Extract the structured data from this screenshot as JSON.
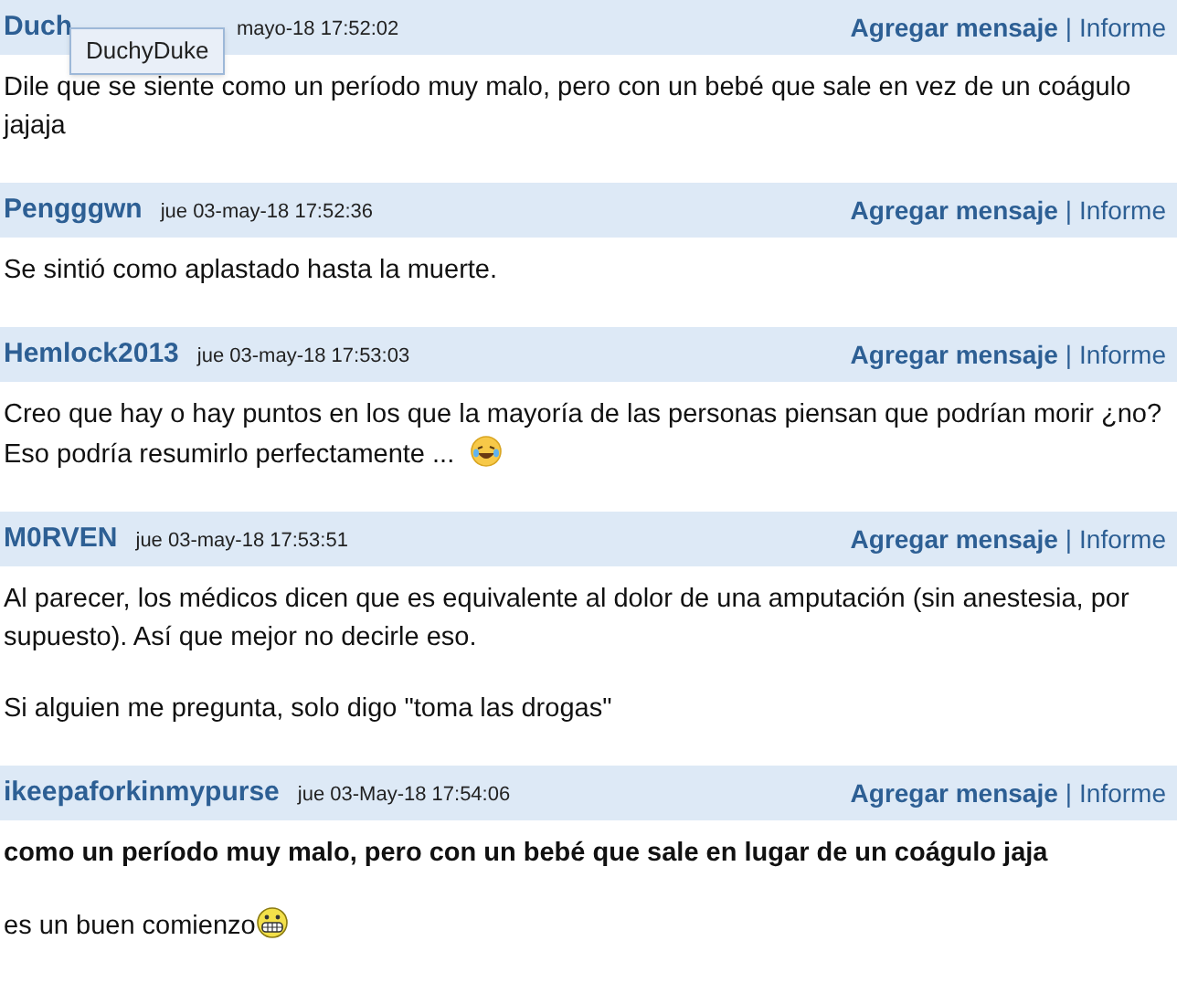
{
  "tooltip": {
    "text": "DuchyDuke"
  },
  "posts": [
    {
      "user": "Duch",
      "date": "mayo-18 17:52:02",
      "actions": {
        "reply": "Agregar mensaje",
        "separator": "|",
        "report": "Informe"
      },
      "paragraphs": [
        {
          "text": "Dile que se siente como un período muy malo, pero con un bebé que sale en vez de un coágulo jajaja",
          "bold": false
        }
      ]
    },
    {
      "user": "Pengggwn",
      "date": "jue 03-may-18 17:52:36",
      "actions": {
        "reply": "Agregar mensaje",
        "separator": "|",
        "report": "Informe"
      },
      "paragraphs": [
        {
          "text": "Se sintió como aplastado hasta la muerte.",
          "bold": false
        }
      ]
    },
    {
      "user": "Hemlock2013",
      "date": "jue 03-may-18 17:53:03",
      "actions": {
        "reply": "Agregar mensaje",
        "separator": "|",
        "report": "Informe"
      },
      "paragraphs": [
        {
          "text": "Creo que hay o hay puntos en los que la mayoría de las personas piensan que podrían morir ¿no? Eso podría resumirlo perfectamente ...",
          "bold": false,
          "kind": "laughing"
        }
      ]
    },
    {
      "user": "M0RVEN",
      "date": "jue 03-may-18 17:53:51",
      "actions": {
        "reply": "Agregar mensaje",
        "separator": "|",
        "report": "Informe"
      },
      "paragraphs": [
        {
          "text": "Al parecer, los médicos dicen que es equivalente al dolor de una amputación (sin anestesia, por supuesto). Así que mejor no decirle eso.",
          "bold": false
        },
        {
          "text": "Si alguien me pregunta, solo digo \"toma las drogas\"",
          "bold": false
        }
      ]
    },
    {
      "user": "ikeepaforkinmypurse",
      "date": "jue 03-May-18 17:54:06",
      "actions": {
        "reply": "Agregar mensaje",
        "separator": "|",
        "report": "Informe"
      },
      "paragraphs": [
        {
          "text": "como un período muy malo, pero con un bebé que sale en lugar de un coágulo jaja",
          "bold": true
        },
        {
          "text": "es un buen comienzo",
          "bold": false,
          "kind": "grinning"
        }
      ]
    }
  ]
}
